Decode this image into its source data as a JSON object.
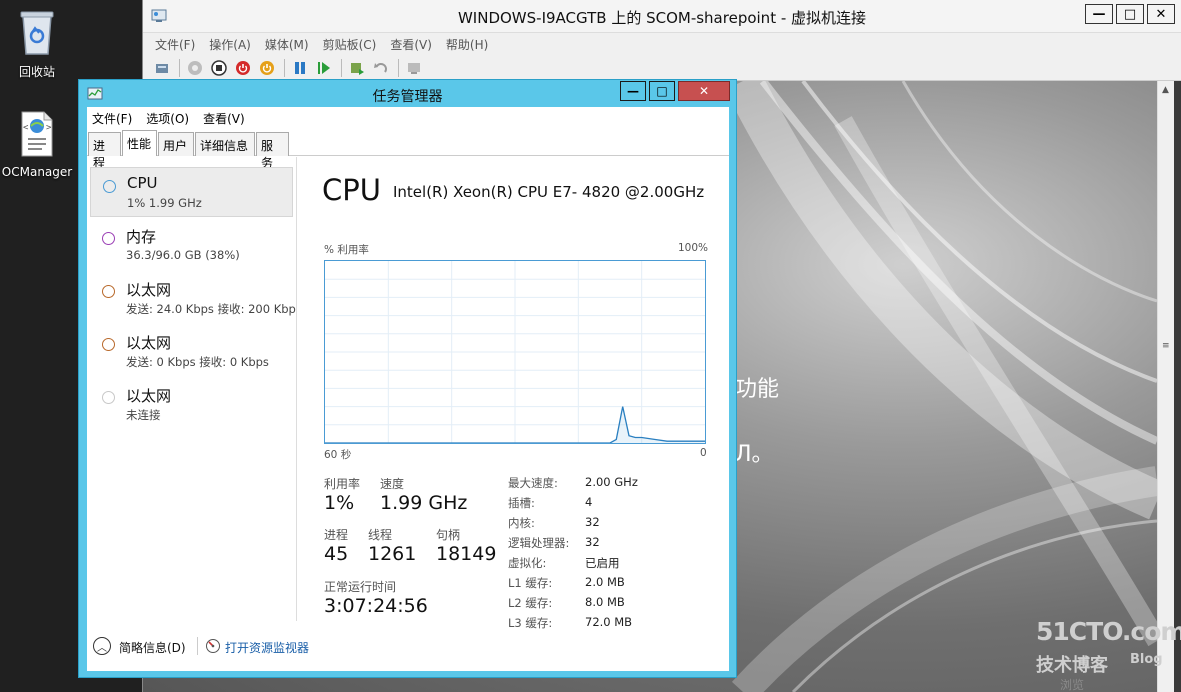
{
  "desktop": {
    "icons": [
      {
        "label": "回收站",
        "icon": "recycle-bin-icon"
      },
      {
        "label": "OCManager",
        "icon": "xml-file-icon"
      }
    ]
  },
  "vm_window": {
    "title": "WINDOWS-I9ACGTB 上的 SCOM-sharepoint - 虚拟机连接",
    "caption": {
      "minimize": "—",
      "maximize": "□",
      "close": "✕"
    },
    "menu": [
      "文件(F)",
      "操作(A)",
      "媒体(M)",
      "剪贴板(C)",
      "查看(V)",
      "帮助(H)"
    ],
    "toolbar": [
      "ctrl-alt-del-icon",
      "start-icon",
      "turn-off-icon",
      "shutdown-icon",
      "power-icon",
      "pause-icon",
      "resume-icon",
      "snapshot-icon",
      "revert-icon",
      "enhanced-session-icon"
    ],
    "guest_text": [
      "功能",
      "Л。"
    ]
  },
  "task_manager": {
    "title": "任务管理器",
    "caption": {
      "minimize": "—",
      "maximize": "□",
      "close": "✕"
    },
    "menu": [
      "文件(F)",
      "选项(O)",
      "查看(V)"
    ],
    "tabs": [
      "进程",
      "性能",
      "用户",
      "详细信息",
      "服务"
    ],
    "active_tab": "性能",
    "resources": [
      {
        "name": "CPU",
        "sub": "1% 1.99 GHz",
        "color": "#4a9bd4",
        "selected": true
      },
      {
        "name": "内存",
        "sub": "36.3/96.0 GB (38%)",
        "color": "#9b3fb5",
        "selected": false
      },
      {
        "name": "以太网",
        "sub": "发送: 24.0 Kbps 接收: 200 Kbps",
        "color": "#b8692b",
        "selected": false
      },
      {
        "name": "以太网",
        "sub": "发送: 0 Kbps 接收: 0 Kbps",
        "color": "#b8692b",
        "selected": false
      },
      {
        "name": "以太网",
        "sub": "未连接",
        "color": "#c8c8c8",
        "selected": false
      }
    ],
    "detail": {
      "heading": "CPU",
      "model": "Intel(R) Xeon(R) CPU E7- 4820 @2.00GHz",
      "graph_ylabel": "% 利用率",
      "graph_ymax": "100%",
      "graph_xleft": "60 秒",
      "graph_xright": "0",
      "stats": {
        "util_label": "利用率",
        "util_value": "1%",
        "speed_label": "速度",
        "speed_value": "1.99 GHz",
        "proc_label": "进程",
        "proc_value": "45",
        "thread_label": "线程",
        "thread_value": "1261",
        "handle_label": "句柄",
        "handle_value": "18149",
        "uptime_label": "正常运行时间",
        "uptime_value": "3:07:24:56"
      },
      "specs": [
        {
          "k": "最大速度:",
          "v": "2.00 GHz"
        },
        {
          "k": "插槽:",
          "v": "4"
        },
        {
          "k": "内核:",
          "v": "32"
        },
        {
          "k": "逻辑处理器:",
          "v": "32"
        },
        {
          "k": "虚拟化:",
          "v": "已启用"
        },
        {
          "k": "L1 缓存:",
          "v": "2.0 MB"
        },
        {
          "k": "L2 缓存:",
          "v": "8.0 MB"
        },
        {
          "k": "L3 缓存:",
          "v": "72.0 MB"
        }
      ]
    },
    "footer": {
      "fewer_details": "简略信息(D)",
      "open_monitor": "打开资源监视器"
    }
  },
  "chart_data": {
    "type": "line",
    "ylim": [
      0,
      100
    ],
    "x": [
      60,
      50,
      45,
      40,
      30,
      20,
      15,
      14,
      13,
      12,
      11,
      10,
      8,
      6,
      4,
      2,
      1,
      0
    ],
    "series": [
      {
        "values": [
          0,
          0,
          0,
          0,
          0,
          0,
          0,
          2,
          20,
          4,
          3,
          3,
          2,
          1,
          1,
          1,
          1,
          1
        ]
      }
    ]
  },
  "watermark": {
    "line1": "51CTO.com",
    "line2": "技术博客",
    "line3": "Blog",
    "partial": "浏览"
  }
}
